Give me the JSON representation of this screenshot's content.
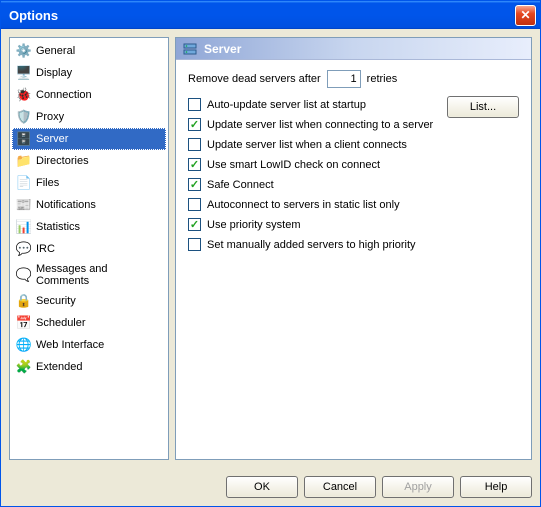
{
  "window": {
    "title": "Options"
  },
  "sidebar": {
    "items": [
      {
        "label": "General",
        "icon": "⚙️",
        "name": "general"
      },
      {
        "label": "Display",
        "icon": "🖥️",
        "name": "display"
      },
      {
        "label": "Connection",
        "icon": "🐞",
        "name": "connection"
      },
      {
        "label": "Proxy",
        "icon": "🛡️",
        "name": "proxy"
      },
      {
        "label": "Server",
        "icon": "🗄️",
        "name": "server",
        "selected": true
      },
      {
        "label": "Directories",
        "icon": "📁",
        "name": "directories"
      },
      {
        "label": "Files",
        "icon": "📄",
        "name": "files"
      },
      {
        "label": "Notifications",
        "icon": "📰",
        "name": "notifications"
      },
      {
        "label": "Statistics",
        "icon": "📊",
        "name": "statistics"
      },
      {
        "label": "IRC",
        "icon": "💬",
        "name": "irc"
      },
      {
        "label": "Messages and Comments",
        "icon": "🗨️",
        "name": "messages"
      },
      {
        "label": "Security",
        "icon": "🔒",
        "name": "security"
      },
      {
        "label": "Scheduler",
        "icon": "📅",
        "name": "scheduler"
      },
      {
        "label": "Web Interface",
        "icon": "🌐",
        "name": "web"
      },
      {
        "label": "Extended",
        "icon": "🧩",
        "name": "extended"
      }
    ]
  },
  "panel": {
    "title": "Server",
    "remove_dead_label_before": "Remove dead servers after",
    "remove_dead_value": "1",
    "remove_dead_label_after": "retries",
    "list_button": "List...",
    "options": [
      {
        "label": "Auto-update server list at startup",
        "checked": false
      },
      {
        "label": "Update server list when connecting to a server",
        "checked": true
      },
      {
        "label": "Update server list when a client connects",
        "checked": false
      },
      {
        "label": "Use smart LowID check on connect",
        "checked": true
      },
      {
        "label": "Safe Connect",
        "checked": true
      },
      {
        "label": "Autoconnect to servers in static list only",
        "checked": false
      },
      {
        "label": "Use priority system",
        "checked": true
      },
      {
        "label": "Set manually added servers to high priority",
        "checked": false
      }
    ]
  },
  "buttons": {
    "ok": "OK",
    "cancel": "Cancel",
    "apply": "Apply",
    "help": "Help"
  }
}
